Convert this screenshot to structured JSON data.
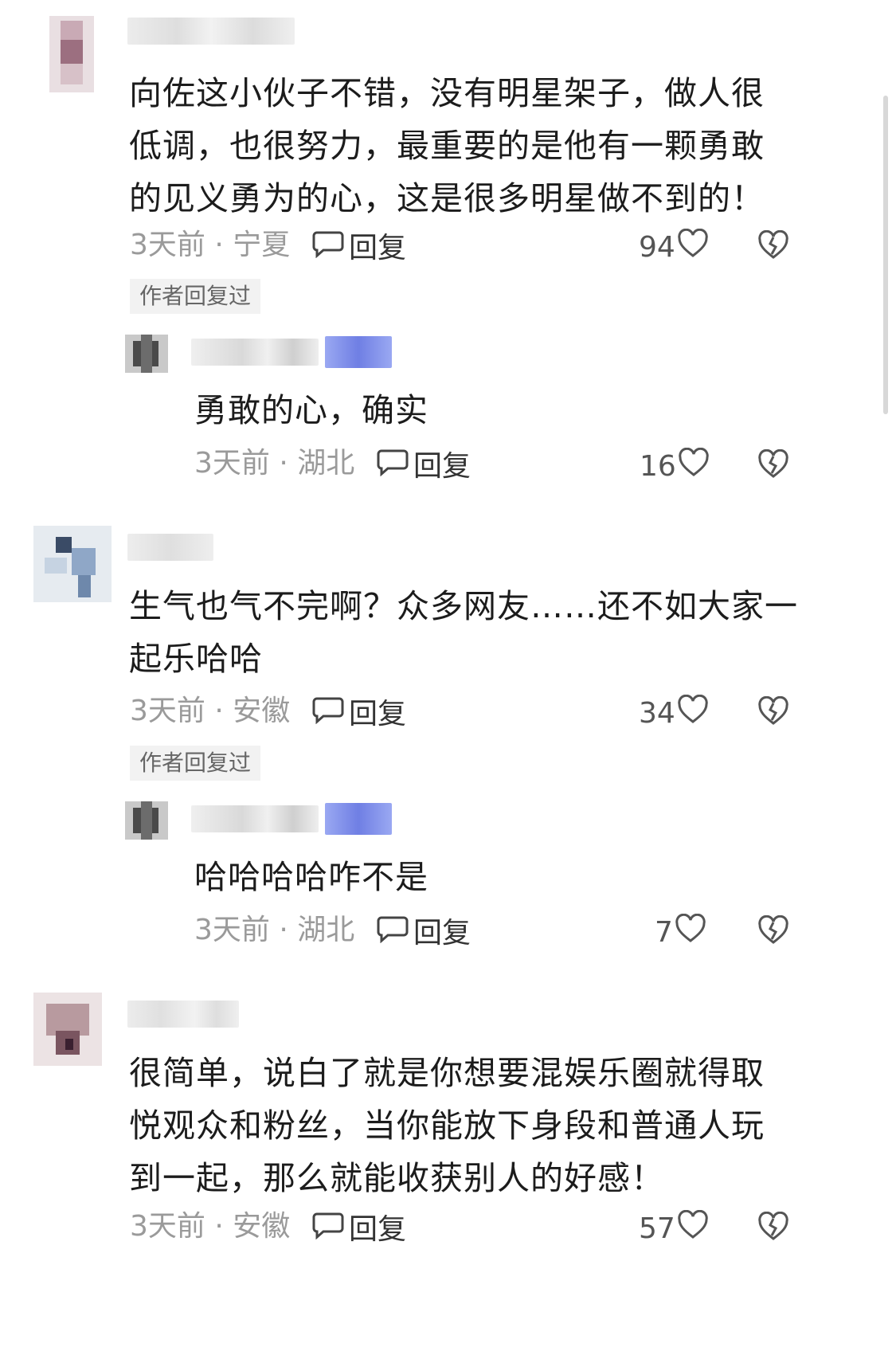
{
  "comments": [
    {
      "text": "向佐这小伙子不错，没有明星架子，做人很低调，也很努力，最重要的是他有一颗勇敢的见义勇为的心，这是很多明星做不到的！",
      "meta": "3天前 · 宁夏",
      "reply_label": "回复",
      "likes": "94",
      "author_tag": "作者回复过",
      "reply": {
        "text": "勇敢的心，确实",
        "meta": "3天前 · 湖北",
        "reply_label": "回复",
        "likes": "16"
      }
    },
    {
      "text": "生气也气不完啊？众多网友……还不如大家一起乐哈哈",
      "meta": "3天前 · 安徽",
      "reply_label": "回复",
      "likes": "34",
      "author_tag": "作者回复过",
      "reply": {
        "text": "哈哈哈哈咋不是",
        "meta": "3天前 · 湖北",
        "reply_label": "回复",
        "likes": "7"
      }
    },
    {
      "text": "很简单，说白了就是你想要混娱乐圈就得取悦观众和粉丝，当你能放下身段和普通人玩到一起，那么就能收获别人的好感！",
      "meta": "3天前 · 安徽",
      "reply_label": "回复",
      "likes": "57"
    }
  ],
  "colors": {
    "text": "#1c1c1c",
    "meta": "#9a9a9a",
    "author_badge_blur": "#8a9af0"
  },
  "icons": [
    "comment-bubble-icon",
    "heart-icon",
    "broken-heart-icon"
  ]
}
